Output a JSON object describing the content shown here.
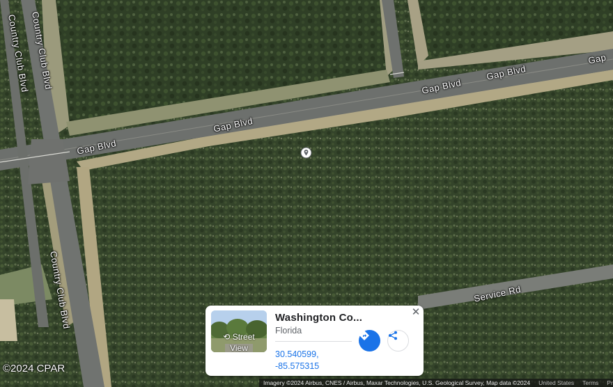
{
  "map": {
    "view": "satellite",
    "roads": [
      {
        "label": "Country Club Blvd"
      },
      {
        "label": "Country Club Blvd"
      },
      {
        "label": "Gap Blvd"
      },
      {
        "label": "Gap Blvd"
      },
      {
        "label": "Gap Blvd"
      },
      {
        "label": "Gap Blvd"
      },
      {
        "label": "Gap"
      },
      {
        "label": "Service Rd"
      }
    ],
    "pin_icon": "location-pin-icon",
    "watermark": "©2024 CPAR",
    "attribution": {
      "imagery": "Imagery ©2024 Airbus, CNES / Airbus, Maxar Technologies, U.S. Geological Survey, Map data ©2024",
      "country": "United States",
      "terms": "Terms",
      "privacy": "Privacy"
    }
  },
  "place_card": {
    "thumbnail_label_line1": "Street",
    "thumbnail_label_line2": "View",
    "title": "Washington Co...",
    "subtitle": "Florida",
    "latitude": "30.540599,",
    "longitude": "-85.575315",
    "directions_icon": "directions-icon",
    "share_icon": "share-icon",
    "close_icon": "close-icon",
    "close_glyph": "✕"
  },
  "colors": {
    "forest": "#3a4a2c",
    "road": "#6f7270",
    "sand": "#b8ab86",
    "accent": "#1a73e8"
  }
}
